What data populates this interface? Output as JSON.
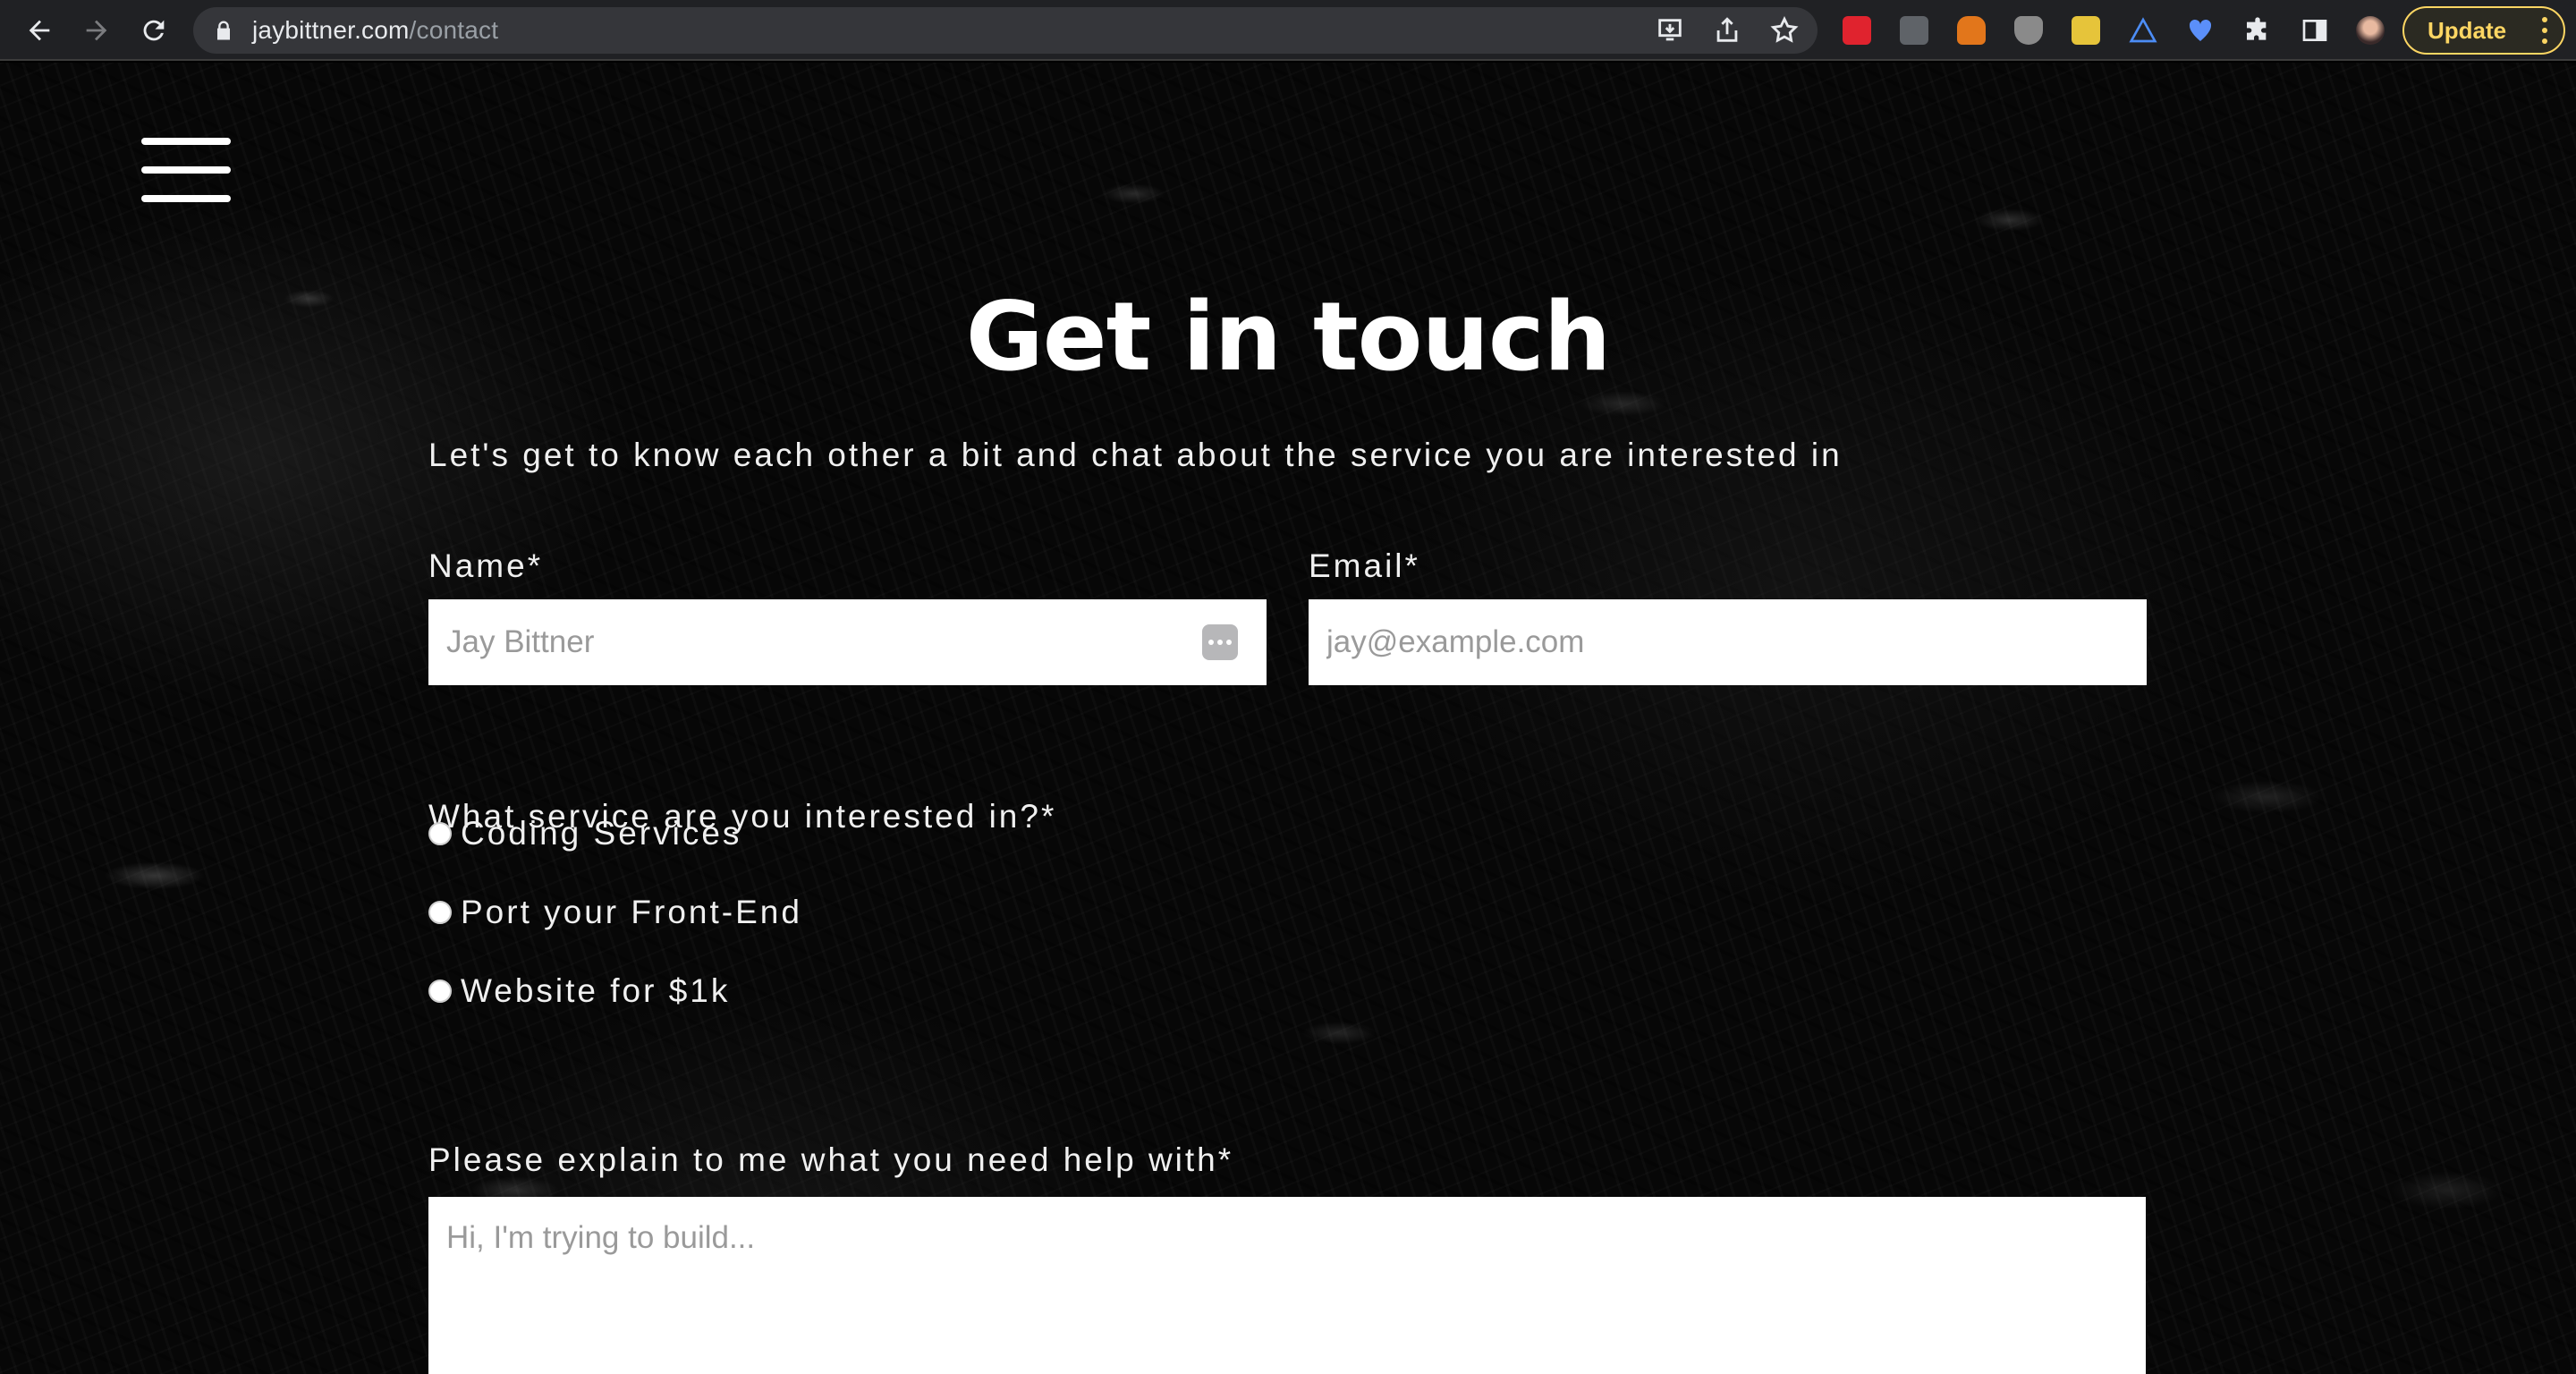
{
  "browser": {
    "url_domain": "jaybittner.com",
    "url_path": "/contact",
    "update_label": "Update",
    "extensions": [
      "screencastify-icon",
      "more-dots-icon",
      "metamask-icon",
      "ublock-icon",
      "image-ext-icon",
      "triangle-ext-icon",
      "heart-key-icon",
      "puzzle-icon",
      "sidepanel-icon",
      "profile-avatar"
    ]
  },
  "page": {
    "title": "Get in touch",
    "intro": "Let's get to know each other a bit and chat about the service you are interested in",
    "name_label": "Name*",
    "name_placeholder": "Jay Bittner",
    "email_label": "Email*",
    "email_placeholder": "jay@example.com",
    "service_question": "What service are you interested in?*",
    "services": [
      "Coding Services",
      "Port your Front-End",
      "Website for $1k"
    ],
    "help_label": "Please explain to me what you need help with*",
    "help_placeholder": "Hi, I'm trying to build..."
  },
  "colors": {
    "background": "#000000",
    "text": "#ffffff",
    "update_accent": "#fdd663"
  }
}
